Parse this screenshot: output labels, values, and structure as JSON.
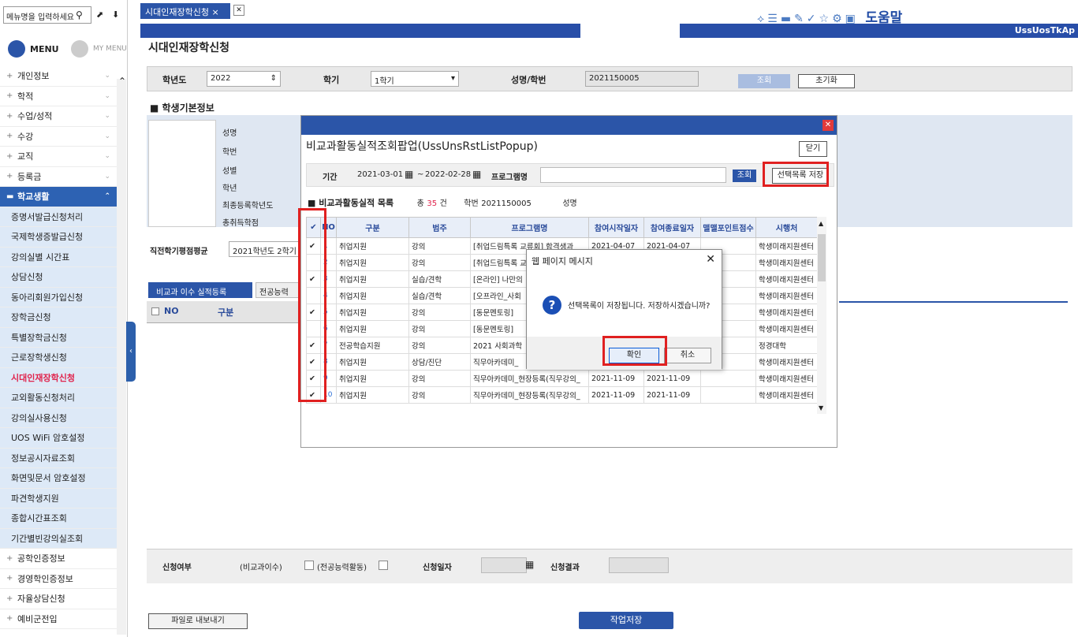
{
  "left_nav": {
    "search_placeholder": "메뉴명을 입력하세요",
    "tab_menu": "MENU",
    "tab_mymenu": "MY MENU",
    "top_items": [
      "개인정보",
      "학적",
      "수업/성적",
      "수강",
      "교직",
      "등록금"
    ],
    "category": "학교생활",
    "sub_items": [
      "증명서발급신청처리",
      "국제학생증발급신청",
      "강의실별 시간표",
      "상담신청",
      "동아리회원가입신청",
      "장학금신청",
      "특별장학금신청",
      "근로장학생신청",
      "시대인재장학신청",
      "교외활동신청처리",
      "강의실사용신청",
      "UOS WiFi 암호설정",
      "정보공시자료조회",
      "화면및문서 암호설정",
      "파견학생지원",
      "종합시간표조회",
      "기간별빈강의실조회"
    ],
    "active_item": "시대인재장학신청",
    "bottom_items": [
      "공학인증정보",
      "경영학인증정보",
      "자율상담신청",
      "예비군전입"
    ]
  },
  "top": {
    "tab_label": "시대인재장학신청",
    "help": "도움말",
    "page_code": "UssUosTkAp",
    "page_title": "시대인재장학신청"
  },
  "search_form": {
    "year_label": "학년도",
    "year_value": "2022",
    "term_label": "학기",
    "term_value": "1학기",
    "name_label": "성명/학번",
    "name_value": "2021150005",
    "search_btn": "조회",
    "reset_btn": "초기화"
  },
  "basic": {
    "section_title": "학생기본정보",
    "labels": [
      "성명",
      "학번",
      "성별",
      "학년",
      "최종등록학년도",
      "총취득학점"
    ],
    "gpa_label": "직전학기평점평균",
    "gpa_value": "2021학년도 2학기",
    "tab1": "비교과 이수 실적등록",
    "tab2": "전공능력",
    "grid_no": "NO",
    "grid_col": "구분"
  },
  "bottom_form": {
    "apply_label": "신청여부",
    "extra_label": "(비교과이수)",
    "major_label": "(전공능력활동)",
    "date_label": "신청일자",
    "result_label": "신청결과",
    "export_btn": "파일로 내보내기",
    "save_btn": "작업저장"
  },
  "popup": {
    "title": "비교과활동실적조회팝업(UssUnsRstListPopup)",
    "close_btn": "닫기",
    "period_label": "기간",
    "date_from": "2021-03-01",
    "date_to": "2022-02-28",
    "program_label": "프로그램명",
    "search_btn": "조회",
    "save_selected_btn": "선택목록 저장",
    "list_title": "비교과활동실적 목록",
    "total_prefix": "총",
    "total_count": "35",
    "total_suffix": "건",
    "student_id_label": "학번",
    "student_id": "2021150005",
    "name_label": "성명",
    "columns": [
      "NO",
      "구분",
      "범주",
      "프로그램명",
      "참여시작일자",
      "참여종료일자",
      "맬맬포인트점수",
      "시행처"
    ],
    "rows": [
      {
        "checked": true,
        "no": "1",
        "type": "취업지원",
        "cat": "강의",
        "prog": "[취업드림특록 교류회] 합격생과",
        "start": "2021-04-07",
        "end": "2021-04-07",
        "org": "학생미래지원센터"
      },
      {
        "checked": false,
        "no": "2",
        "type": "취업지원",
        "cat": "강의",
        "prog": "[취업드림특록 교류회]",
        "start": "",
        "end": "",
        "org": "학생미래지원센터"
      },
      {
        "checked": true,
        "no": "3",
        "type": "취업지원",
        "cat": "실습/견학",
        "prog": "[온라인] 나만의",
        "start": "",
        "end": "",
        "org": "학생미래지원센터"
      },
      {
        "checked": false,
        "no": "4",
        "type": "취업지원",
        "cat": "실습/견학",
        "prog": "[오프라인_사회",
        "start": "",
        "end": "",
        "org": "학생미래지원센터"
      },
      {
        "checked": true,
        "no": "5",
        "type": "취업지원",
        "cat": "강의",
        "prog": "[동문멘토링]",
        "start": "",
        "end": "",
        "org": "학생미래지원센터"
      },
      {
        "checked": false,
        "no": "6",
        "type": "취업지원",
        "cat": "강의",
        "prog": "[동문멘토링]",
        "start": "",
        "end": "",
        "org": "학생미래지원센터"
      },
      {
        "checked": true,
        "no": "7",
        "type": "전공학습지원",
        "cat": "강의",
        "prog": "2021 사회과학",
        "start": "",
        "end": "",
        "org": "정경대학"
      },
      {
        "checked": true,
        "no": "8",
        "type": "취업지원",
        "cat": "상담/진단",
        "prog": "직무아카데미_",
        "start": "",
        "end": "",
        "org": "학생미래지원센터"
      },
      {
        "checked": true,
        "no": "9",
        "type": "취업지원",
        "cat": "강의",
        "prog": "직무아카데미_현장등록(직무강의_",
        "start": "2021-11-09",
        "end": "2021-11-09",
        "org": "학생미래지원센터"
      },
      {
        "checked": true,
        "no": "10",
        "type": "취업지원",
        "cat": "강의",
        "prog": "직무아카데미_현장등록(직무강의_",
        "start": "2021-11-09",
        "end": "2021-11-09",
        "org": "학생미래지원센터"
      }
    ]
  },
  "message": {
    "title": "웹 페이지 메시지",
    "text": "선택목록이 저장됩니다. 저장하시겠습니까?",
    "ok": "확인",
    "cancel": "취소"
  },
  "colors": {
    "primary": "#2b55a8",
    "highlight": "#e02020",
    "active_menu": "#e0234c"
  }
}
